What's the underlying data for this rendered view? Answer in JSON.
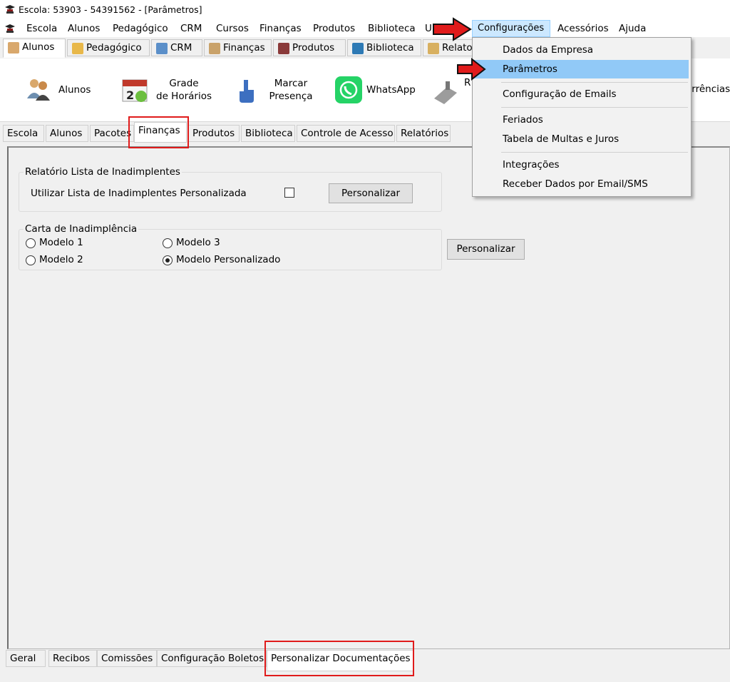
{
  "window": {
    "title": "Escola: 53903 - 54391562 - [Parâmetros]"
  },
  "menubar": {
    "items": [
      "Escola",
      "Alunos",
      "Pedagógico",
      "CRM",
      "Cursos",
      "Finanças",
      "Produtos",
      "Biblioteca",
      "U"
    ],
    "open_menu": "Configurações",
    "after": [
      "Acessórios",
      "Ajuda"
    ]
  },
  "module_tabs": [
    "Alunos",
    "Pedagógico",
    "CRM",
    "Finanças",
    "Produtos",
    "Biblioteca",
    "Relato"
  ],
  "toolbar": {
    "alunos": "Alunos",
    "grade_line1": "Grade",
    "grade_line2": "de Horários",
    "marcar_line1": "Marcar",
    "marcar_line2": "Presença",
    "whatsapp": "WhatsApp",
    "r_partial": "R",
    "ocorrencias_partial": "orrências"
  },
  "param_tabs": [
    "Escola",
    "Alunos",
    "Pacotes",
    "Finanças",
    "Produtos",
    "Biblioteca",
    "Controle de Acesso",
    "Relatórios"
  ],
  "inadimplentes": {
    "legend": "Relatório Lista de Inadimplentes",
    "checkbox_label": "Utilizar Lista de Inadimplentes Personalizada",
    "button": "Personalizar"
  },
  "carta": {
    "legend": "Carta de Inadimplência",
    "modelo1": "Modelo 1",
    "modelo2": "Modelo 2",
    "modelo3": "Modelo 3",
    "personalizado": "Modelo Personalizado",
    "selected": "Modelo Personalizado",
    "button": "Personalizar"
  },
  "bottom_tabs": [
    "Geral",
    "Recibos",
    "Comissões",
    "Configuração Boletos",
    "Personalizar Documentações"
  ],
  "dropdown": {
    "items": [
      "Dados da Empresa",
      "Parâmetros",
      "Configuração de Emails",
      "Feriados",
      "Tabela de Multas e Juros",
      "Integrações",
      "Receber Dados por Email/SMS"
    ],
    "highlighted": "Parâmetros"
  },
  "colors": {
    "highlight": "#91c9f7",
    "annotation": "#e01b1b",
    "menu_open": "#cce8ff"
  }
}
